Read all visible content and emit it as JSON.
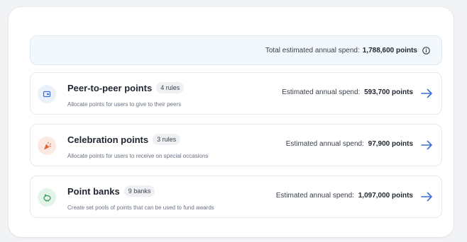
{
  "summary": {
    "label": "Total estimated annual spend:",
    "value": "1,788,600 points",
    "info_icon": "info-icon"
  },
  "rows": [
    {
      "title": "Peer-to-peer points",
      "badge": "4 rules",
      "description": "Allocate points for users to give to their peers",
      "spend_label": "Estimated annual spend:",
      "spend_value": "593,700 points",
      "icon": "wallet-icon",
      "icon_bg": "#eaf1fb",
      "icon_color": "#3b6fd4"
    },
    {
      "title": "Celebration points",
      "badge": "3 rules",
      "description": "Allocate points for users to receive on special occasions",
      "spend_label": "Estimated annual spend:",
      "spend_value": "97,900 points",
      "icon": "party-popper-icon",
      "icon_bg": "#fde9e4",
      "icon_color": "#e0603c"
    },
    {
      "title": "Point banks",
      "badge": "9 banks",
      "description": "Create set pools of points that can be used to fund awards",
      "spend_label": "Estimated annual spend:",
      "spend_value": "1,097,000 points",
      "icon": "piggy-bank-icon",
      "icon_bg": "#e4f4e9",
      "icon_color": "#2f9a56"
    }
  ],
  "colors": {
    "arrow": "#3b6fd4"
  }
}
